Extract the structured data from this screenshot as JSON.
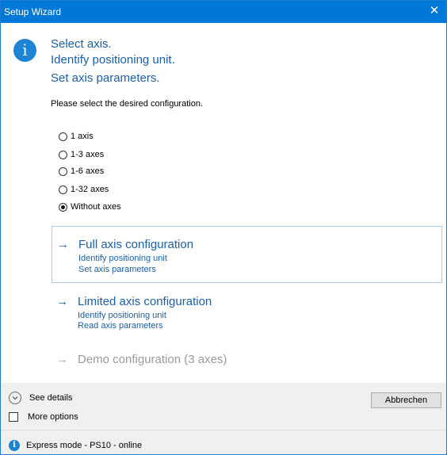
{
  "window": {
    "title": "Setup Wizard",
    "close_glyph": "✕"
  },
  "header": {
    "icon": "info-icon",
    "lines": [
      "Select axis.",
      "Identify positioning unit.",
      "Set axis parameters."
    ]
  },
  "prompt": "Please select the desired configuration.",
  "radio_options": [
    {
      "label": "1 axis",
      "checked": false
    },
    {
      "label": "1-3 axes",
      "checked": false
    },
    {
      "label": "1-6 axes",
      "checked": false
    },
    {
      "label": "1-32 axes",
      "checked": false
    },
    {
      "label": "Without axes",
      "checked": true
    }
  ],
  "config_options": [
    {
      "title": "Full axis configuration",
      "sub": [
        "Identify positioning unit",
        "Set axis parameters"
      ],
      "enabled": true,
      "selected": true
    },
    {
      "title": "Limited axis configuration",
      "sub": [
        "Identify positioning unit",
        "Read axis parameters"
      ],
      "enabled": true,
      "selected": false
    },
    {
      "title": "Demo configuration (3 axes)",
      "sub": [],
      "enabled": false,
      "selected": false
    }
  ],
  "footer": {
    "details_label": "See details",
    "more_options_label": "More options",
    "more_options_checked": false,
    "cancel_label": "Abbrechen"
  },
  "status": {
    "icon": "info-icon",
    "text": "Express mode - PS10 - online"
  },
  "colors": {
    "titlebar": "#0078d7",
    "heading_text": "#1a60a8",
    "selected_border": "#a9cfee",
    "disabled_text": "#9a9a9a",
    "footer_bg": "#f0f0f0"
  }
}
